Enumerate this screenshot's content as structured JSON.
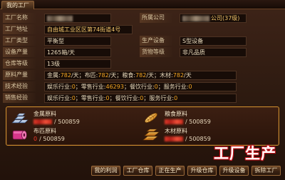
{
  "header": {
    "title": "我的工厂"
  },
  "info": {
    "name_label": "工厂名称",
    "company_label": "所属公司",
    "company_suffix": "公司(37级)",
    "address_label": "工厂地址",
    "address": "自由城工业区区第74街道4号",
    "type_label": "工厂类型",
    "type": "平衡型",
    "equipment_label": "生产设备",
    "equipment": "S型设备",
    "output_label": "设备产量",
    "output": "1265箱/天",
    "grade_label": "货物等级",
    "grade": "非凡品质",
    "warehouse_label": "仓库等级",
    "warehouse": "13级",
    "raw_label": "原料产量",
    "raw": [
      {
        "name": "金属:",
        "value": "782",
        "sep": "/天；"
      },
      {
        "name": "布匹:",
        "value": "782",
        "sep": "/天；"
      },
      {
        "name": "粮食:",
        "value": "782",
        "sep": "/天；"
      },
      {
        "name": "木材:",
        "value": "782",
        "sep": "/天"
      }
    ],
    "tech_label": "技术经验",
    "tech": [
      {
        "name": "娱乐行业:",
        "value": "0",
        "sep": "；"
      },
      {
        "name": "零售行业:",
        "value": "46293",
        "sep": "；"
      },
      {
        "name": "餐饮行业:",
        "value": "0",
        "sep": "；"
      },
      {
        "name": "服务行业:",
        "value": "0"
      }
    ],
    "sales_label": "销售经验",
    "sales": [
      {
        "name": "娱乐行业:",
        "value": "0",
        "sep": "；"
      },
      {
        "name": "零售行业:",
        "value": "0",
        "sep": "；"
      },
      {
        "name": "餐饮行业:",
        "value": "0",
        "sep": "；"
      },
      {
        "name": "服务行业:",
        "value": "0"
      }
    ]
  },
  "materials": [
    {
      "name": "金属原料",
      "max": "/ 500859",
      "icon": "metal-ingot-icon"
    },
    {
      "name": "粮食原料",
      "max": "/ 500859",
      "icon": "grain-icon"
    },
    {
      "name": "布匹原料",
      "current": "0",
      "max": "/ 500859",
      "icon": "fabric-roll-icon"
    },
    {
      "name": "木材原料",
      "max": "/ 500859",
      "icon": "wood-planks-icon"
    }
  ],
  "caption": "工厂生产",
  "buttons": [
    "我的利润",
    "工厂仓库",
    "正在生产",
    "升级仓库",
    "升级设备",
    "拆除工厂"
  ],
  "colors": {
    "accent": "#f3a622",
    "material_red": "#ee3a2a",
    "border_gold": "#c98a2c",
    "caption_outline": "#c8141e"
  }
}
